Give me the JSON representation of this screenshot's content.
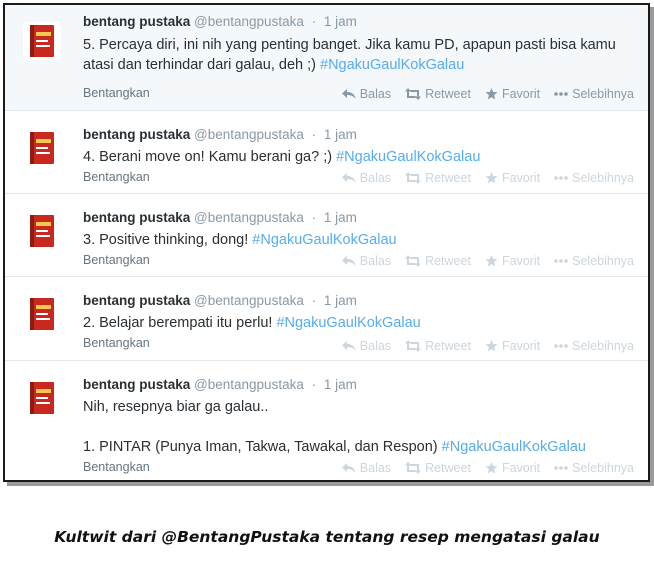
{
  "tweets": [
    {
      "name": "bentang pustaka",
      "handle": "@bentangpustaka",
      "time": "1 jam",
      "text": "5. Percaya diri, ini nih yang penting banget. Jika kamu PD, apapun pasti bisa kamu atasi dan terhindar dari galau, deh ;)",
      "hashtag": "#NgakuGaulKokGalau",
      "expand": "Bentangkan",
      "reply": "Balas",
      "retweet": "Retweet",
      "favorite": "Favorit",
      "more": "Selebihnya"
    },
    {
      "name": "bentang pustaka",
      "handle": "@bentangpustaka",
      "time": "1 jam",
      "text": "4. Berani move on! Kamu berani ga? ;)",
      "hashtag": "#NgakuGaulKokGalau",
      "expand": "Bentangkan",
      "reply": "Balas",
      "retweet": "Retweet",
      "favorite": "Favorit",
      "more": "Selebihnya"
    },
    {
      "name": "bentang pustaka",
      "handle": "@bentangpustaka",
      "time": "1 jam",
      "text": "3. Positive thinking, dong!",
      "hashtag": "#NgakuGaulKokGalau",
      "expand": "Bentangkan",
      "reply": "Balas",
      "retweet": "Retweet",
      "favorite": "Favorit",
      "more": "Selebihnya"
    },
    {
      "name": "bentang pustaka",
      "handle": "@bentangpustaka",
      "time": "1 jam",
      "text": "2. Belajar berempati itu perlu!",
      "hashtag": "#NgakuGaulKokGalau",
      "expand": "Bentangkan",
      "reply": "Balas",
      "retweet": "Retweet",
      "favorite": "Favorit",
      "more": "Selebihnya"
    },
    {
      "name": "bentang pustaka",
      "handle": "@bentangpustaka",
      "time": "1 jam",
      "text": "Nih, resepnya biar ga galau..",
      "text_line2": "1. PINTAR (Punya Iman, Takwa, Tawakal, dan Respon)",
      "hashtag": "#NgakuGaulKokGalau",
      "expand": "Bentangkan",
      "reply": "Balas",
      "retweet": "Retweet",
      "favorite": "Favorit",
      "more": "Selebihnya"
    }
  ],
  "caption": "Kultwit dari @BentangPustaka tentang resep mengatasi galau",
  "colors": {
    "hashtag": "#55acee",
    "name": "#292f33",
    "meta": "#8899a6",
    "action_faded": "#ccd6dd",
    "avatar_red": "#c8281e"
  },
  "icons": [
    "book-avatar-icon",
    "reply-icon",
    "retweet-icon",
    "star-icon",
    "ellipsis-icon"
  ]
}
